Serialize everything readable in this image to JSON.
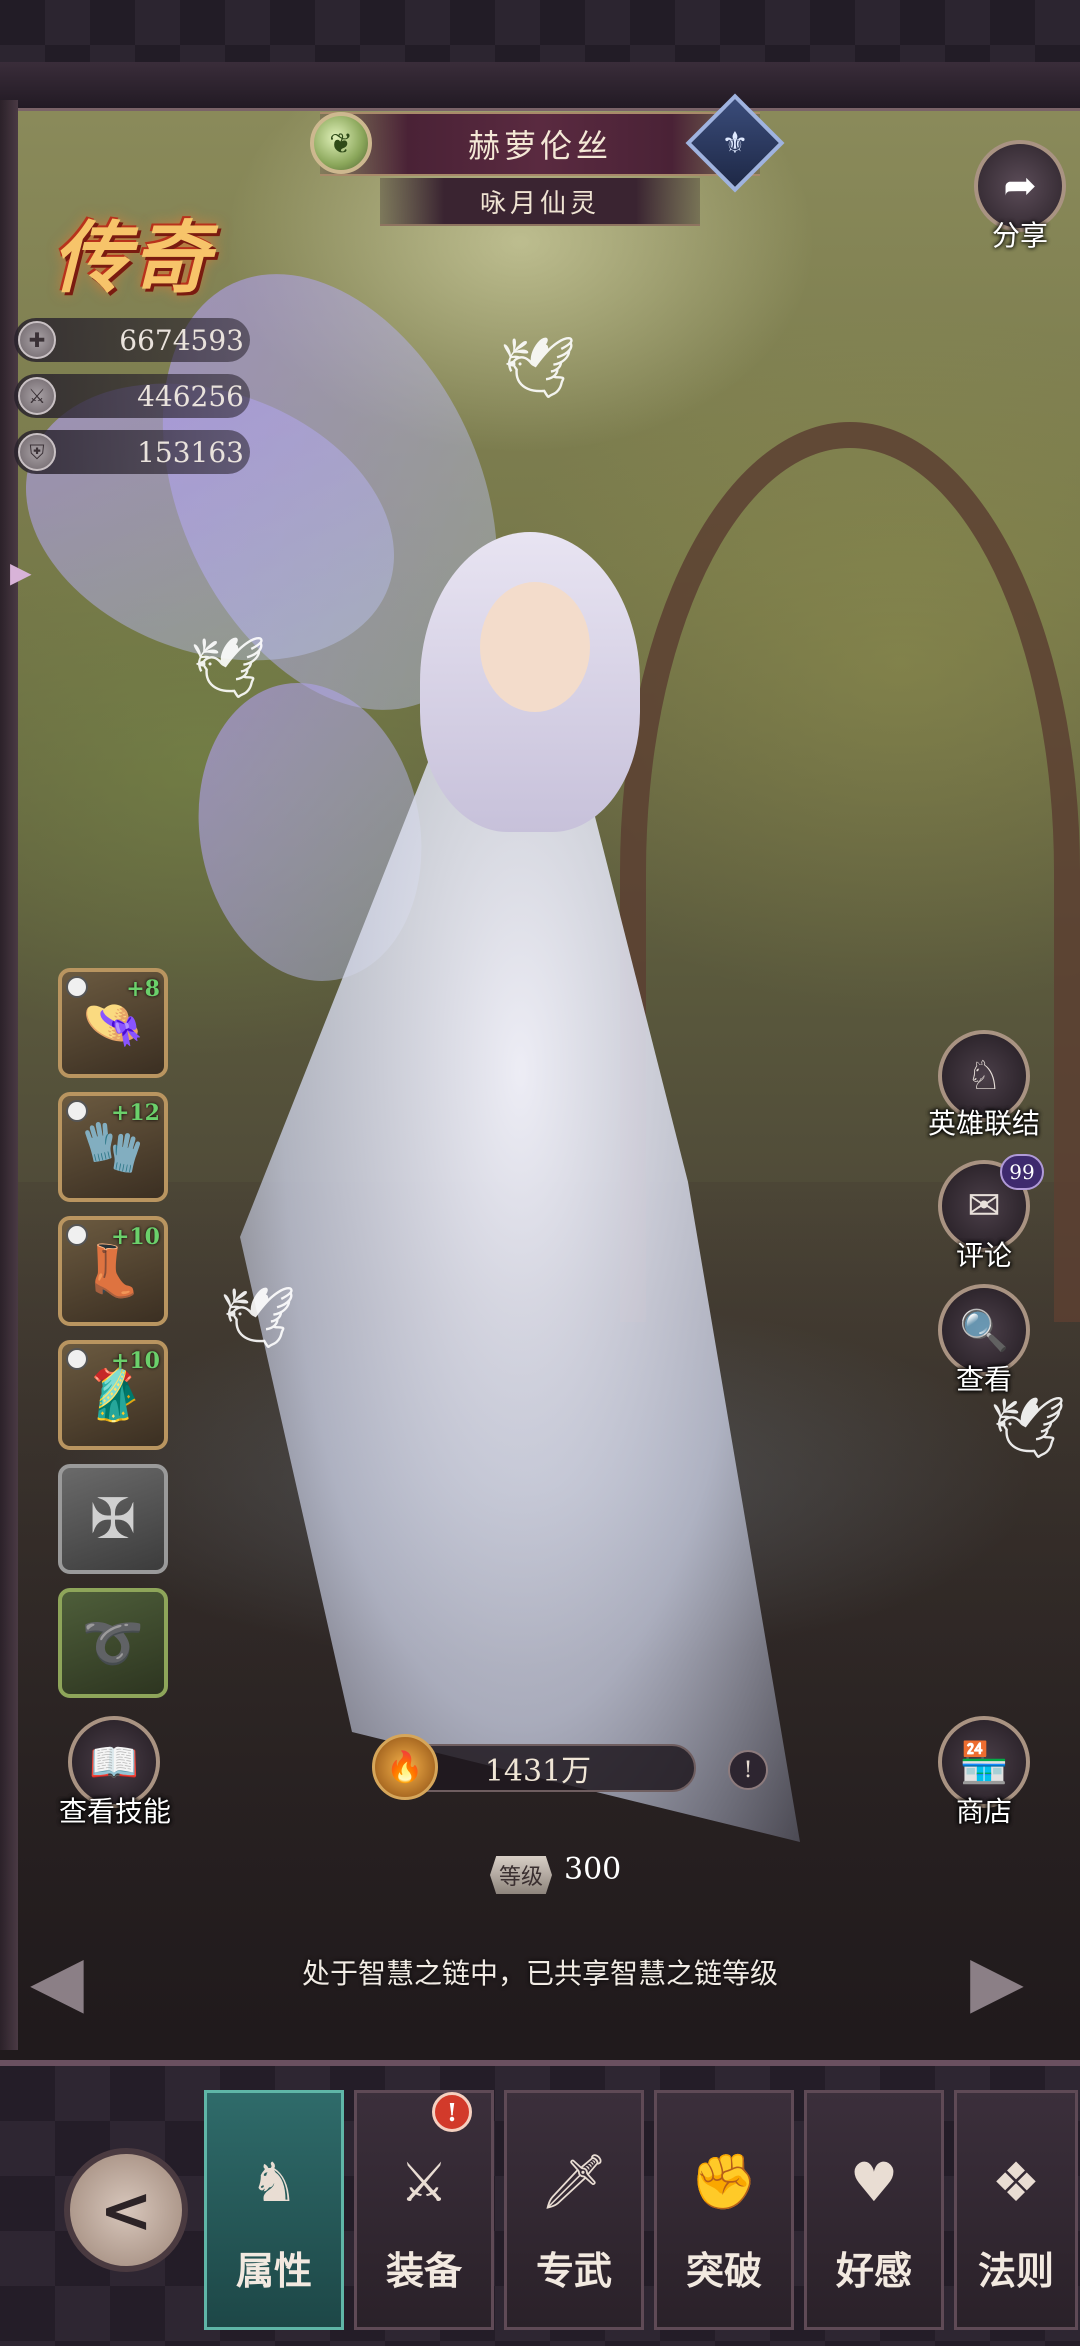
{
  "hero": {
    "name": "赫萝伦丝",
    "title": "咏月仙灵",
    "rarity": "传奇"
  },
  "stats": [
    {
      "icon": "hp-icon",
      "value": "6674593"
    },
    {
      "icon": "attack-icon",
      "value": "446256"
    },
    {
      "icon": "defense-icon",
      "value": "153163"
    }
  ],
  "share": {
    "label": "分享"
  },
  "equipment": [
    {
      "name": "helmet",
      "plus": "+8"
    },
    {
      "name": "gloves",
      "plus": "+12"
    },
    {
      "name": "boots",
      "plus": "+10"
    },
    {
      "name": "armor",
      "plus": "+10"
    }
  ],
  "actions": {
    "hero_link": "英雄联结",
    "comment": "评论",
    "comment_count": "99",
    "view": "查看",
    "view_skills": "查看技能",
    "shop": "商店"
  },
  "power": {
    "value": "1431万"
  },
  "level": {
    "label": "等级",
    "value": "300"
  },
  "chain_message": "处于智慧之链中，已共享智慧之链等级",
  "tabs": [
    {
      "label": "属性",
      "active": true
    },
    {
      "label": "装备",
      "alert": "!"
    },
    {
      "label": "专武"
    },
    {
      "label": "突破"
    },
    {
      "label": "好感"
    },
    {
      "label": "法则"
    }
  ]
}
